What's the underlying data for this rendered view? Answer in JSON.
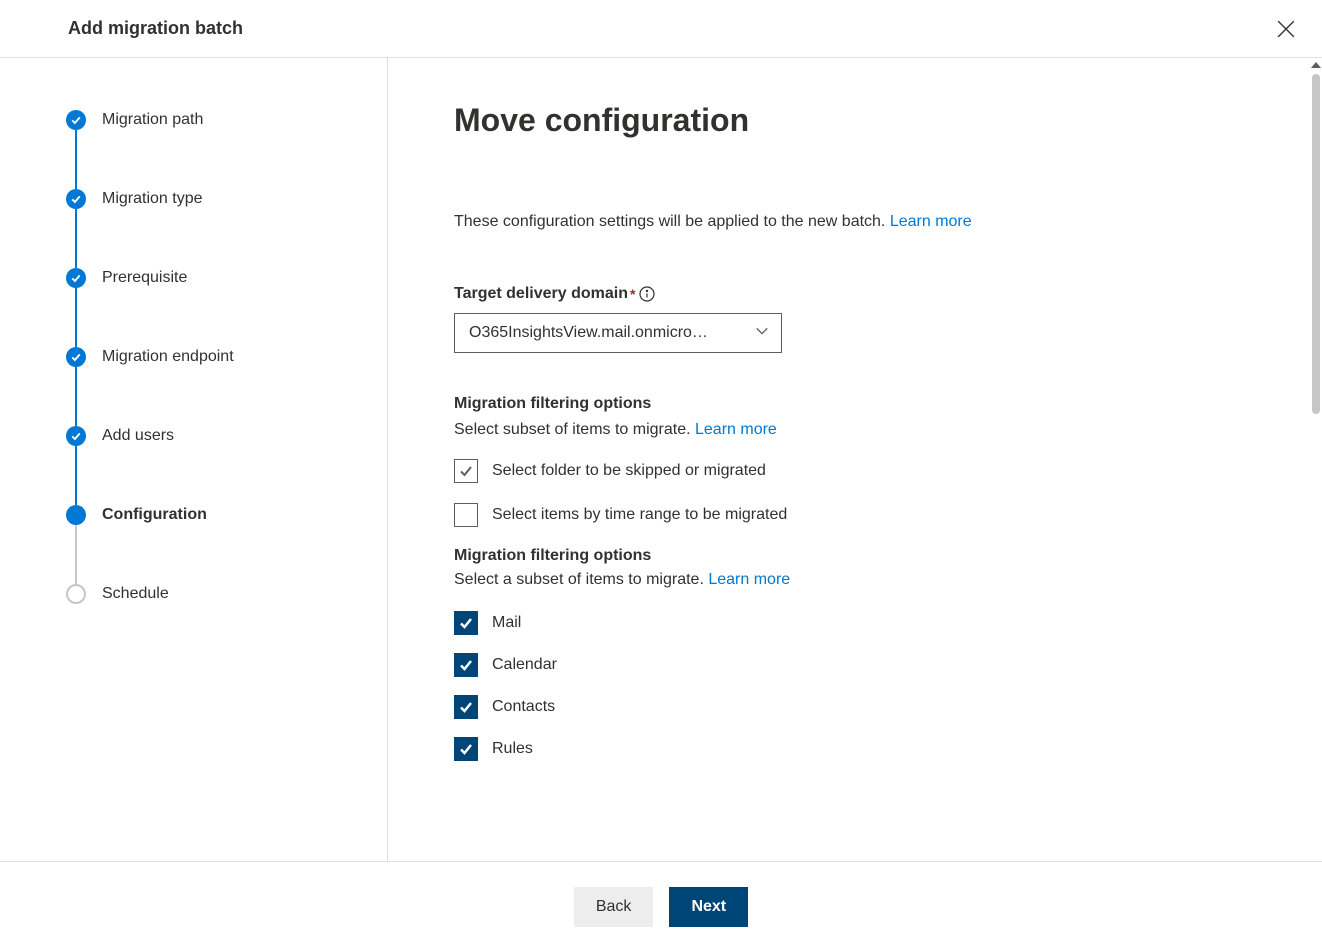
{
  "header": {
    "title": "Add migration batch"
  },
  "steps": [
    {
      "label": "Migration path",
      "state": "completed"
    },
    {
      "label": "Migration type",
      "state": "completed"
    },
    {
      "label": "Prerequisite",
      "state": "completed"
    },
    {
      "label": "Migration endpoint",
      "state": "completed"
    },
    {
      "label": "Add users",
      "state": "completed"
    },
    {
      "label": "Configuration",
      "state": "current"
    },
    {
      "label": "Schedule",
      "state": "pending"
    }
  ],
  "main": {
    "title": "Move configuration",
    "intro": "These configuration settings will be applied to the new batch. ",
    "intro_link": "Learn more",
    "target_domain": {
      "label": "Target delivery domain",
      "value": "O365InsightsView.mail.onmicro…"
    },
    "filter1": {
      "title": "Migration filtering options",
      "desc": "Select subset of items to migrate. ",
      "desc_link": "Learn more",
      "opt_folder": "Select folder to be skipped or migrated",
      "opt_time": "Select items by time range to be migrated"
    },
    "filter2": {
      "title": "Migration filtering options",
      "desc": "Select a subset of items to migrate. ",
      "desc_link": "Learn more",
      "items": {
        "mail": "Mail",
        "calendar": "Calendar",
        "contacts": "Contacts",
        "rules": "Rules"
      }
    }
  },
  "footer": {
    "back": "Back",
    "next": "Next"
  }
}
